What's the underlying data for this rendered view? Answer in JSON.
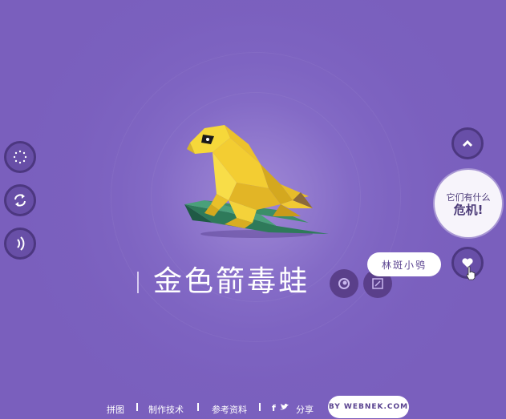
{
  "page": {
    "title": "金色箭毒蛙",
    "background_color": "#7a5fbd"
  },
  "left_controls": [
    {
      "name": "loading-dots-icon"
    },
    {
      "name": "refresh-arrows-icon"
    },
    {
      "name": "sound-waves-icon"
    }
  ],
  "right_controls": {
    "up_icon": "chevron-up-icon",
    "danger_bubble": {
      "line1": "它们有什么",
      "line2": "危机!"
    },
    "down_icon": "heart-icon"
  },
  "tooltip": {
    "label": "林斑小鸮"
  },
  "actions": [
    {
      "name": "eye-icon"
    },
    {
      "name": "edit-icon"
    }
  ],
  "footer": {
    "links": [
      "拼图",
      "制作技术",
      "参考资料"
    ],
    "share_label": "分享",
    "social_icons": [
      "facebook-icon",
      "twitter-icon"
    ],
    "by_label": "BY WEBNEK.COM"
  }
}
